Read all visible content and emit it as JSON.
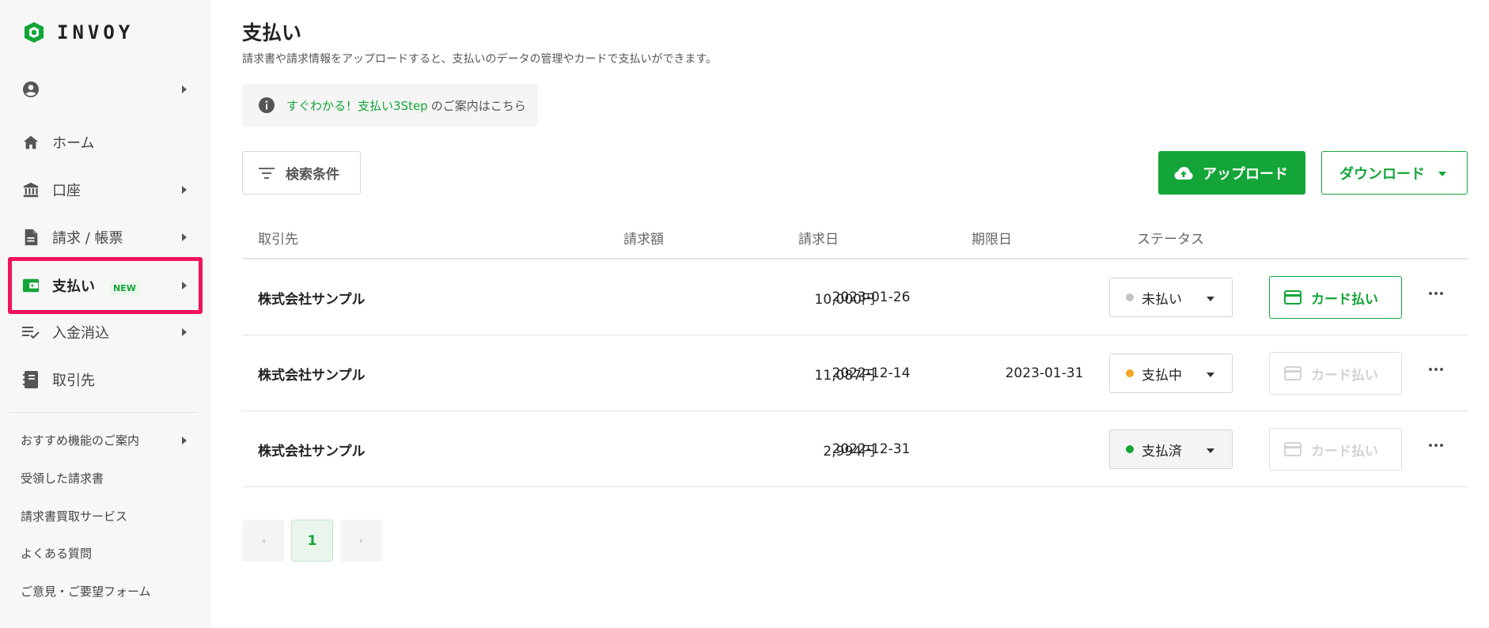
{
  "brand": {
    "name": "INVOY",
    "accent": "#13a538",
    "highlight": "#f0145a"
  },
  "sidebar": {
    "account_icon": "user-circle-icon",
    "items": [
      {
        "label": "ホーム",
        "icon": "home-icon"
      },
      {
        "label": "口座",
        "icon": "bank-icon"
      },
      {
        "label": "請求 / 帳票",
        "icon": "document-icon"
      },
      {
        "label": "支払い",
        "icon": "wallet-icon",
        "badge": "NEW",
        "active": true
      },
      {
        "label": "入金消込",
        "icon": "checklist-icon"
      },
      {
        "label": "取引先",
        "icon": "contacts-book-icon"
      }
    ],
    "links": [
      "おすすめ機能のご案内",
      "受領した請求書",
      "請求書買取サービス",
      "よくある質問",
      "ご意見・ご要望フォーム"
    ]
  },
  "main": {
    "title": "支払い",
    "description": "請求書や請求情報をアップロードすると、支払いのデータの管理やカードで支払いができます。",
    "info": {
      "link": "すぐわかる！支払い3Step",
      "rest": "のご案内はこちら"
    },
    "filter_label": "検索条件",
    "upload_label": "アップロード",
    "download_label": "ダウンロード",
    "table": {
      "headers": [
        "取引先",
        "請求額",
        "請求日",
        "期限日",
        "ステータス"
      ],
      "rows": [
        {
          "vendor": "株式会社サンプル",
          "amount": "10,000円",
          "date": "2023-01-26",
          "due": "",
          "status": "未払い",
          "status_color": "#c4c4c4",
          "card_label": "カード払い",
          "card_enabled": true
        },
        {
          "vendor": "株式会社サンプル",
          "amount": "11,087円",
          "date": "2022-12-14",
          "due": "2023-01-31",
          "status": "支払中",
          "status_color": "#f5a623",
          "card_label": "カード払い",
          "card_enabled": false
        },
        {
          "vendor": "株式会社サンプル",
          "amount": "2,994円",
          "date": "2022-12-31",
          "due": "",
          "status": "支払済",
          "status_color": "#13a538",
          "card_label": "カード払い",
          "card_enabled": false
        }
      ]
    },
    "pagination": {
      "current": "1"
    }
  }
}
